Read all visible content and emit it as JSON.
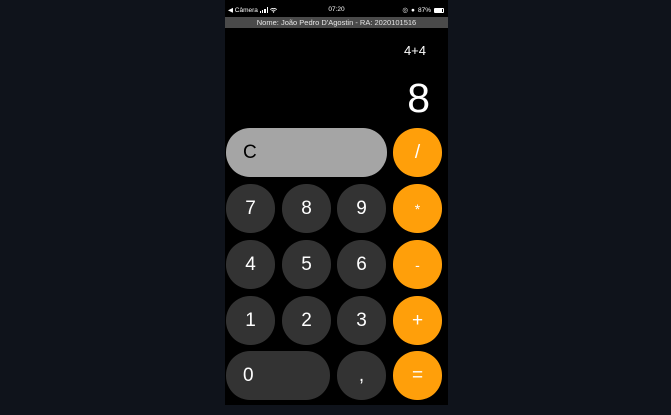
{
  "status_bar": {
    "back_label": "◀ Câmera",
    "time": "07:20",
    "battery": "87%"
  },
  "banner": "Nome: João Pedro D'Agostin - RA: 2020101516",
  "display": {
    "expression": "4+4",
    "result": "8"
  },
  "buttons": {
    "clear": "C",
    "divide": "/",
    "seven": "7",
    "eight": "8",
    "nine": "9",
    "multiply": "*",
    "four": "4",
    "five": "5",
    "six": "6",
    "subtract": "-",
    "one": "1",
    "two": "2",
    "three": "3",
    "add": "+",
    "zero": "0",
    "comma": ",",
    "equals": "="
  },
  "colors": {
    "operator": "#ff9f0a",
    "digit": "#333333",
    "function": "#a5a5a5",
    "background": "#000000"
  }
}
